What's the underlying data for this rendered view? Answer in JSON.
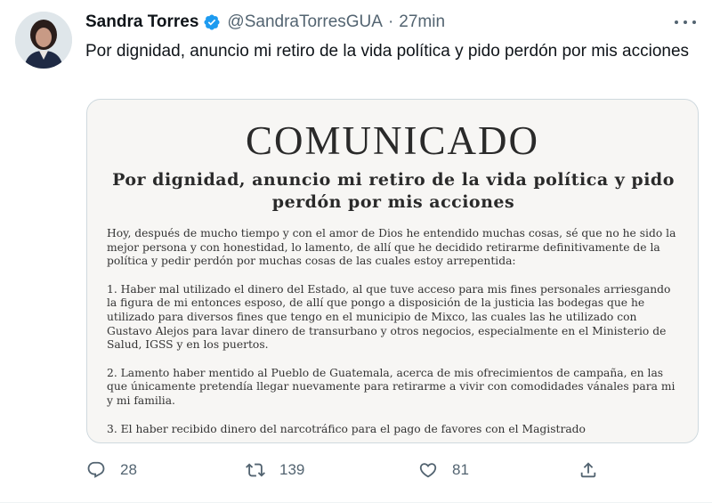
{
  "tweet": {
    "author_name": "Sandra Torres",
    "handle": "@SandraTorresGUA",
    "separator": "·",
    "time": "27min",
    "text": "Por dignidad, anuncio mi retiro de la vida política y pido perdón por mis acciones"
  },
  "document": {
    "title": "COMUNICADO",
    "subtitle": "Por dignidad, anuncio mi retiro de la vida política y pido perdón por mis acciones",
    "paragraphs": [
      "Hoy, después de mucho tiempo y con el amor de Dios he entendido muchas cosas, sé que no he sido la mejor persona y con honestidad, lo lamento, de allí que he decidido retirarme definitivamente de la política y pedir perdón por muchas cosas de las cuales estoy arrepentida:",
      "1. Haber mal utilizado el dinero del Estado, al que tuve acceso para mis fines personales arriesgando la figura de mi entonces esposo, de allí que pongo a disposición de la justicia las bodegas que he utilizado para diversos fines que tengo en el municipio de Mixco, las cuales las he utilizado con Gustavo Alejos para lavar dinero de transurbano y otros negocios, especialmente en el Ministerio de Salud, IGSS y en los puertos.",
      "2. Lamento haber mentido al Pueblo de Guatemala, acerca de mis ofrecimientos de campaña, en las que únicamente pretendía llegar nuevamente para retirarme a vivir con comodidades vánales para mi y mi familia.",
      "3. El haber recibido dinero del narcotráfico para el pago de favores con el Magistrado"
    ]
  },
  "actions": {
    "reply_count": "28",
    "retweet_count": "139",
    "like_count": "81"
  },
  "icons": {
    "verified": "verified-badge-icon",
    "more": "more-horizontal-icon",
    "reply": "reply-icon",
    "retweet": "retweet-icon",
    "like": "heart-icon",
    "share": "share-icon"
  },
  "colors": {
    "verified_blue": "#1d9bf0",
    "secondary_text": "#536471",
    "document_background": "#f7f6f4"
  }
}
